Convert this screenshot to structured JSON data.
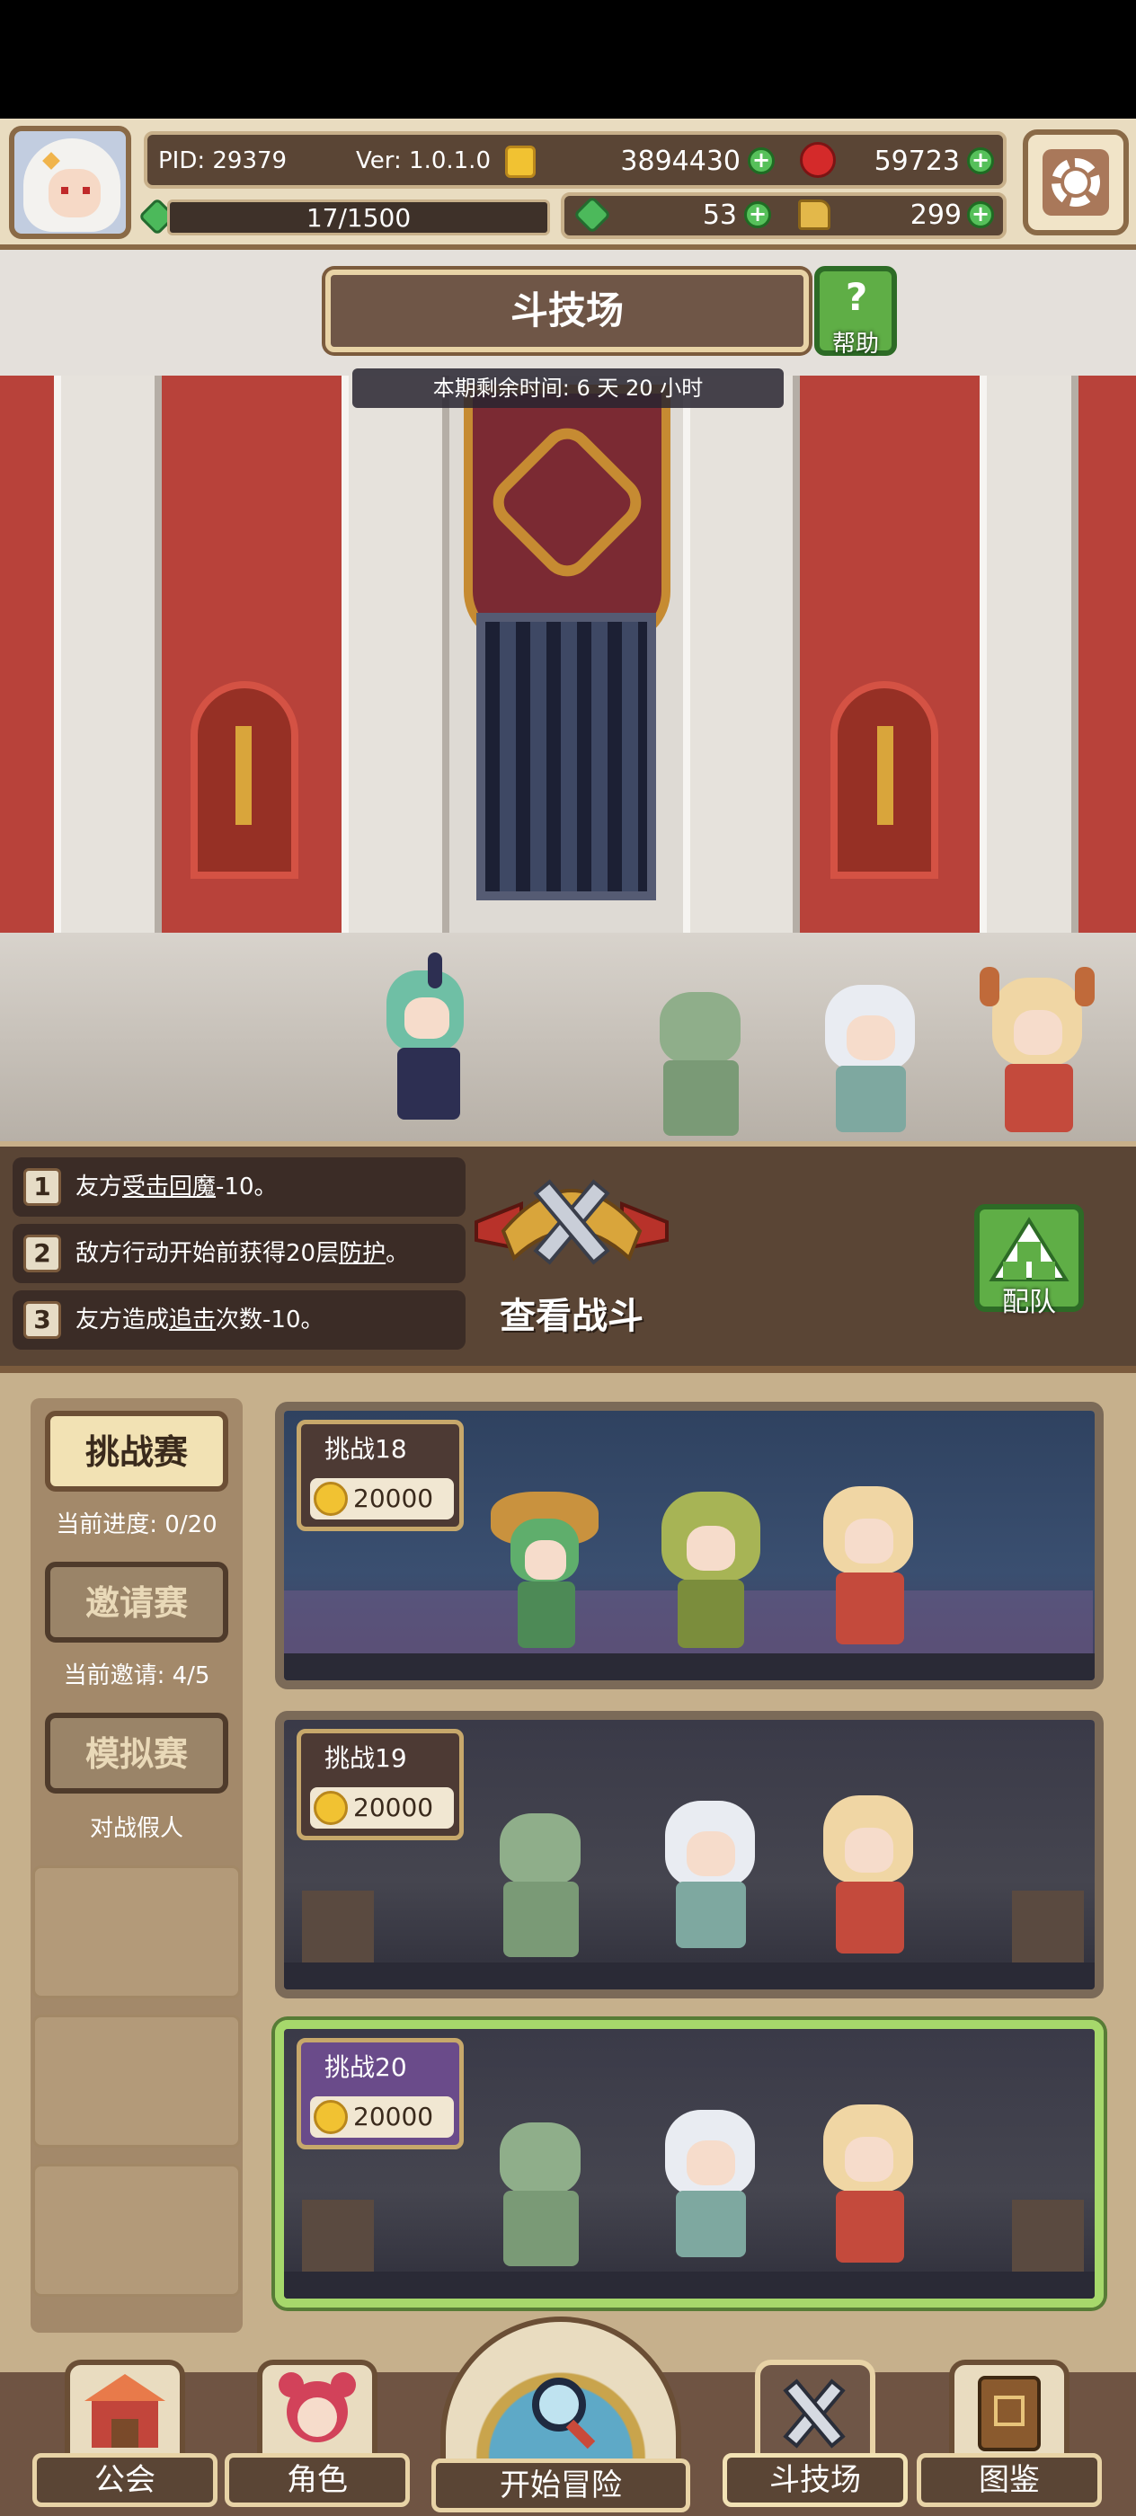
{
  "header": {
    "pid": "PID: 29379",
    "version": "Ver: 1.0.1.0",
    "gold": "3894430",
    "gems": "59723",
    "stamina": "17/1500",
    "clovers": "53",
    "boots": "299"
  },
  "arena": {
    "title": "斗技场",
    "help_label": "帮助",
    "timer": "本期剩余时间: 6 天 20 小时"
  },
  "rules": [
    {
      "num": "1",
      "pre": "友方",
      "mark": "受击回魔",
      "post": "-10。"
    },
    {
      "num": "2",
      "pre": "敌方行动开始前获得20层",
      "mark": "防护",
      "post": "。"
    },
    {
      "num": "3",
      "pre": "友方造成",
      "mark": "追击",
      "post": "次数-10。"
    }
  ],
  "actions": {
    "view_battle": "查看战斗",
    "team": "配队"
  },
  "modes": {
    "challenge": {
      "label": "挑战赛",
      "note": "当前进度: 0/20"
    },
    "invite": {
      "label": "邀请赛",
      "note": "当前邀请: 4/5"
    },
    "simulate": {
      "label": "模拟赛",
      "note": "对战假人"
    }
  },
  "challenges": [
    {
      "title": "挑战18",
      "reward": "20000"
    },
    {
      "title": "挑战19",
      "reward": "20000"
    },
    {
      "title": "挑战20",
      "reward": "20000"
    }
  ],
  "nav": {
    "guild": "公会",
    "character": "角色",
    "adventure": "开始冒险",
    "arena": "斗技场",
    "codex": "图鉴"
  },
  "colors": {
    "panel_brown": "#5a4535",
    "panel_beige": "#e9dcc0",
    "accent_green": "#5fae46",
    "selected_border": "#a6d86b"
  },
  "icons": [
    "gold-coin-icon",
    "ruby-icon",
    "clover-icon",
    "boot-icon",
    "settings-gear-icon",
    "help-icon",
    "crossed-swords-icon",
    "team-icon",
    "guild-icon",
    "character-icon",
    "magnifier-icon",
    "codex-icon"
  ]
}
